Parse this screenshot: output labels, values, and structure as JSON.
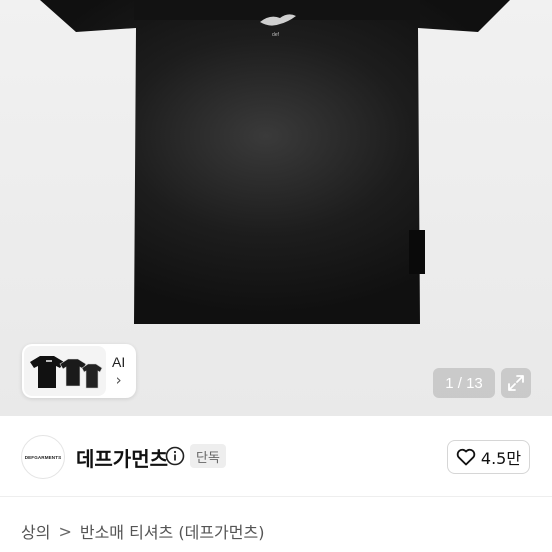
{
  "gallery": {
    "ai_label": "AI",
    "chevron": "›",
    "counter": "1 / 13"
  },
  "seller": {
    "logo_text": "DEFGARMENTS",
    "name": "데프가먼츠",
    "badge": "단독",
    "follow_count": "4.5만"
  },
  "breadcrumb": {
    "category": "상의",
    "separator": ">",
    "product": "반소매 티셔츠 (데프가먼츠)"
  },
  "icons": [
    "info-icon",
    "heart-icon",
    "expand-icon",
    "chevron-right-icon"
  ],
  "colors": {
    "shirt": "#111111",
    "badge_bg": "#eeeeee",
    "text": "#111111"
  }
}
